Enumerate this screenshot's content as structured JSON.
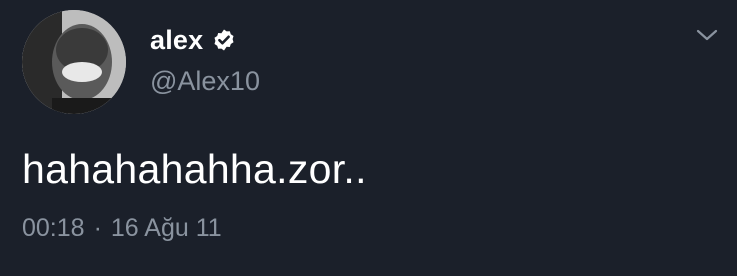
{
  "author": {
    "display_name": "alex",
    "handle": "@Alex10",
    "verified": true,
    "avatar_icon": "profile-photo"
  },
  "tweet": {
    "text": "hahahahahha.zor..",
    "time": "00:18",
    "separator": "·",
    "date": "16 Ağu 11"
  },
  "icons": {
    "menu": "chevron-down-icon",
    "verified": "verified-badge-icon"
  },
  "colors": {
    "background": "#1b202a",
    "primary_text": "#ffffff",
    "secondary_text": "#8a939f"
  }
}
